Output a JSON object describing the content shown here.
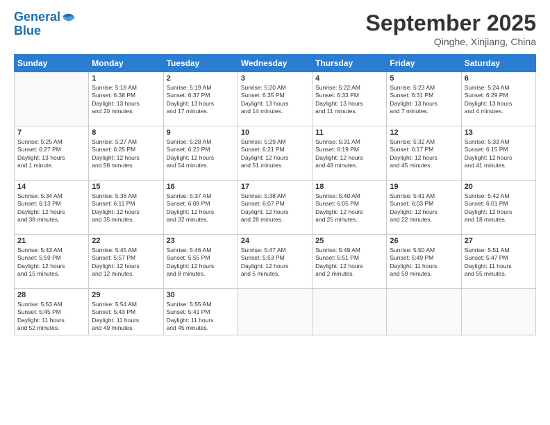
{
  "logo": {
    "line1": "General",
    "line2": "Blue"
  },
  "header": {
    "month": "September 2025",
    "location": "Qinghe, Xinjiang, China"
  },
  "days_of_week": [
    "Sunday",
    "Monday",
    "Tuesday",
    "Wednesday",
    "Thursday",
    "Friday",
    "Saturday"
  ],
  "weeks": [
    [
      {
        "day": "",
        "info": ""
      },
      {
        "day": "1",
        "info": "Sunrise: 5:18 AM\nSunset: 6:38 PM\nDaylight: 13 hours\nand 20 minutes."
      },
      {
        "day": "2",
        "info": "Sunrise: 5:19 AM\nSunset: 6:37 PM\nDaylight: 13 hours\nand 17 minutes."
      },
      {
        "day": "3",
        "info": "Sunrise: 5:20 AM\nSunset: 6:35 PM\nDaylight: 13 hours\nand 14 minutes."
      },
      {
        "day": "4",
        "info": "Sunrise: 5:22 AM\nSunset: 6:33 PM\nDaylight: 13 hours\nand 11 minutes."
      },
      {
        "day": "5",
        "info": "Sunrise: 5:23 AM\nSunset: 6:31 PM\nDaylight: 13 hours\nand 7 minutes."
      },
      {
        "day": "6",
        "info": "Sunrise: 5:24 AM\nSunset: 6:29 PM\nDaylight: 13 hours\nand 4 minutes."
      }
    ],
    [
      {
        "day": "7",
        "info": "Sunrise: 5:25 AM\nSunset: 6:27 PM\nDaylight: 13 hours\nand 1 minute."
      },
      {
        "day": "8",
        "info": "Sunrise: 5:27 AM\nSunset: 6:25 PM\nDaylight: 12 hours\nand 58 minutes."
      },
      {
        "day": "9",
        "info": "Sunrise: 5:28 AM\nSunset: 6:23 PM\nDaylight: 12 hours\nand 54 minutes."
      },
      {
        "day": "10",
        "info": "Sunrise: 5:29 AM\nSunset: 6:21 PM\nDaylight: 12 hours\nand 51 minutes."
      },
      {
        "day": "11",
        "info": "Sunrise: 5:31 AM\nSunset: 6:19 PM\nDaylight: 12 hours\nand 48 minutes."
      },
      {
        "day": "12",
        "info": "Sunrise: 5:32 AM\nSunset: 6:17 PM\nDaylight: 12 hours\nand 45 minutes."
      },
      {
        "day": "13",
        "info": "Sunrise: 5:33 AM\nSunset: 6:15 PM\nDaylight: 12 hours\nand 41 minutes."
      }
    ],
    [
      {
        "day": "14",
        "info": "Sunrise: 5:34 AM\nSunset: 6:13 PM\nDaylight: 12 hours\nand 38 minutes."
      },
      {
        "day": "15",
        "info": "Sunrise: 5:36 AM\nSunset: 6:11 PM\nDaylight: 12 hours\nand 35 minutes."
      },
      {
        "day": "16",
        "info": "Sunrise: 5:37 AM\nSunset: 6:09 PM\nDaylight: 12 hours\nand 32 minutes."
      },
      {
        "day": "17",
        "info": "Sunrise: 5:38 AM\nSunset: 6:07 PM\nDaylight: 12 hours\nand 28 minutes."
      },
      {
        "day": "18",
        "info": "Sunrise: 5:40 AM\nSunset: 6:05 PM\nDaylight: 12 hours\nand 25 minutes."
      },
      {
        "day": "19",
        "info": "Sunrise: 5:41 AM\nSunset: 6:03 PM\nDaylight: 12 hours\nand 22 minutes."
      },
      {
        "day": "20",
        "info": "Sunrise: 5:42 AM\nSunset: 6:01 PM\nDaylight: 12 hours\nand 18 minutes."
      }
    ],
    [
      {
        "day": "21",
        "info": "Sunrise: 5:43 AM\nSunset: 5:59 PM\nDaylight: 12 hours\nand 15 minutes."
      },
      {
        "day": "22",
        "info": "Sunrise: 5:45 AM\nSunset: 5:57 PM\nDaylight: 12 hours\nand 12 minutes."
      },
      {
        "day": "23",
        "info": "Sunrise: 5:46 AM\nSunset: 5:55 PM\nDaylight: 12 hours\nand 8 minutes."
      },
      {
        "day": "24",
        "info": "Sunrise: 5:47 AM\nSunset: 5:53 PM\nDaylight: 12 hours\nand 5 minutes."
      },
      {
        "day": "25",
        "info": "Sunrise: 5:49 AM\nSunset: 5:51 PM\nDaylight: 12 hours\nand 2 minutes."
      },
      {
        "day": "26",
        "info": "Sunrise: 5:50 AM\nSunset: 5:49 PM\nDaylight: 11 hours\nand 59 minutes."
      },
      {
        "day": "27",
        "info": "Sunrise: 5:51 AM\nSunset: 5:47 PM\nDaylight: 11 hours\nand 55 minutes."
      }
    ],
    [
      {
        "day": "28",
        "info": "Sunrise: 5:53 AM\nSunset: 5:45 PM\nDaylight: 11 hours\nand 52 minutes."
      },
      {
        "day": "29",
        "info": "Sunrise: 5:54 AM\nSunset: 5:43 PM\nDaylight: 11 hours\nand 49 minutes."
      },
      {
        "day": "30",
        "info": "Sunrise: 5:55 AM\nSunset: 5:41 PM\nDaylight: 11 hours\nand 45 minutes."
      },
      {
        "day": "",
        "info": ""
      },
      {
        "day": "",
        "info": ""
      },
      {
        "day": "",
        "info": ""
      },
      {
        "day": "",
        "info": ""
      }
    ]
  ]
}
